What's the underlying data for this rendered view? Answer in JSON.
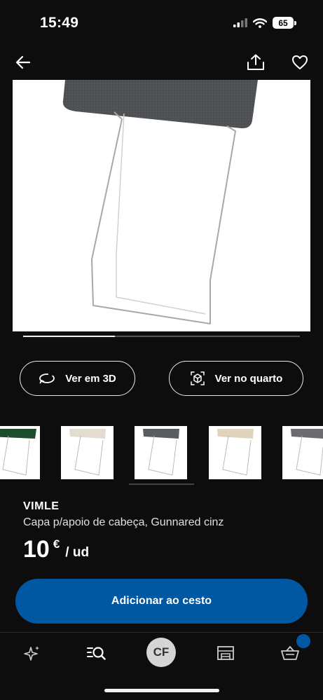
{
  "status_bar": {
    "time": "15:49",
    "battery": "65"
  },
  "header": {
    "back_icon": "arrow-left-icon",
    "share_icon": "share-icon",
    "favorite_icon": "heart-icon"
  },
  "gallery": {
    "progress": 0.33
  },
  "actions": {
    "view_3d": "Ver em 3D",
    "view_room": "Ver no quarto"
  },
  "thumbnails": [
    {
      "color": "#1d4d2c"
    },
    {
      "color": "#e3ddd0"
    },
    {
      "color": "#5a5d60"
    },
    {
      "color": "#e2d3bf"
    },
    {
      "color": "#6a6c6f"
    }
  ],
  "product": {
    "brand": "VIMLE",
    "description": "Capa p/apoio de cabeça, Gunnared cinz",
    "price": "10",
    "currency": "€",
    "unit": "/ ud"
  },
  "cart_button": "Adicionar ao cesto",
  "tabbar": {
    "avatar_initials": "CF"
  },
  "colors": {
    "accent": "#0058a3",
    "background": "#0d0d0d"
  }
}
